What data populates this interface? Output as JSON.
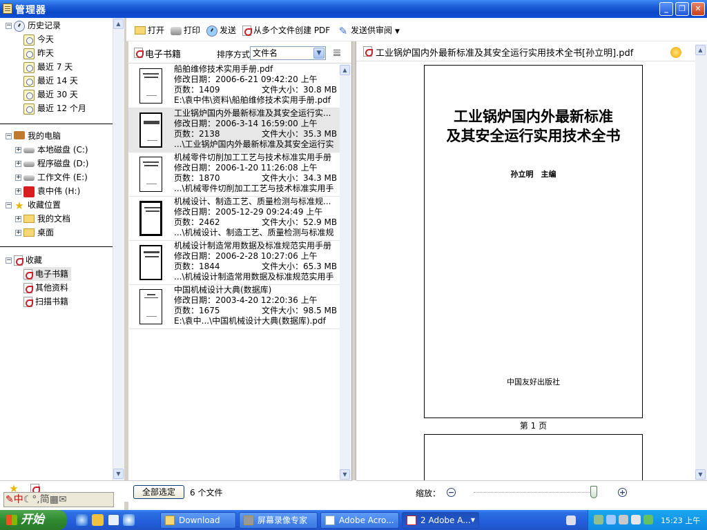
{
  "window": {
    "title": "管理器"
  },
  "sidebar": {
    "history": {
      "label": "历史记录",
      "items": [
        "今天",
        "昨天",
        "最近 7 天",
        "最近 14 天",
        "最近 30 天",
        "最近 12 个月"
      ]
    },
    "computer": {
      "label": "我的电脑",
      "drives": [
        "本地磁盘 (C:)",
        "程序磁盘 (D:)",
        "工作文件 (E:)",
        "袁中伟 (H:)"
      ]
    },
    "favorites_loc": {
      "label": "收藏位置",
      "items": [
        "我的文档",
        "桌面"
      ]
    },
    "collection": {
      "label": "收藏",
      "items": [
        "电子书籍",
        "其他资料",
        "扫描书籍"
      ]
    }
  },
  "toolbar": {
    "open": "打开",
    "print": "打印",
    "send": "发送",
    "create_pdf": "从多个文件创建 PDF",
    "review": "发送供审阅"
  },
  "list": {
    "title": "电子书籍",
    "sort_label": "排序方式",
    "sort_value": "文件名",
    "files": [
      {
        "name": "船舶维修技术实用手册.pdf",
        "date": "修改日期：2006-6-21 09:42:20 上午",
        "pages": "页数：1409",
        "size": "文件大小：30.8 MB",
        "path": "E:\\袁中伟\\资料\\船舶维修技术实用手册.pdf"
      },
      {
        "name": "工业锅炉国内外最新标准及其安全运行实...",
        "date": "修改日期：2006-3-14 16:59:00 上午",
        "pages": "页数：2138",
        "size": "文件大小：35.3 MB",
        "path": "...\\工业锅炉国内外最新标准及其安全运行实"
      },
      {
        "name": "机械零件切削加工工艺与技术标准实用手册",
        "date": "修改日期：2006-1-20 11:26:08 上午",
        "pages": "页数：1870",
        "size": "文件大小：34.3 MB",
        "path": "...\\机械零件切削加工工艺与技术标准实用手"
      },
      {
        "name": "机械设计、制造工艺、质量检测与标准规...",
        "date": "修改日期：2005-12-29 09:24:49 上午",
        "pages": "页数：2462",
        "size": "文件大小：52.9 MB",
        "path": "...\\机械设计、制造工艺、质量检测与标准规"
      },
      {
        "name": "机械设计制造常用数据及标准规范实用手册",
        "date": "修改日期：2006-2-28 10:27:06 上午",
        "pages": "页数：1844",
        "size": "文件大小：65.3 MB",
        "path": "...\\机械设计制造常用数据及标准规范实用手"
      },
      {
        "name": "中国机械设计大典(数据库)",
        "date": "修改日期：2003-4-20 12:20:36 上午",
        "pages": "页数：1675",
        "size": "文件大小：98.5 MB",
        "path": "E:\\袁中...\\中国机械设计大典(数据库).pdf"
      }
    ],
    "select_all": "全部选定",
    "count": "6 个文件"
  },
  "preview": {
    "file_title": "工业锅炉国内外最新标准及其安全运行实用技术全书[孙立明].pdf",
    "cover_title_line1": "工业锅炉国内外最新标准",
    "cover_title_line2": "及其安全运行实用技术全书",
    "cover_author": "孙立明　主编",
    "cover_publisher": "中国友好出版社",
    "page_label": "第 1 页",
    "zoom_label": "缩放：",
    "zoom_level": 0.95
  },
  "ime": {
    "text": "中"
  },
  "taskbar": {
    "start": "开始",
    "tasks": [
      "Download",
      "屏幕录像专家",
      "Adobe Acro...",
      "2 Adobe A..."
    ],
    "clock": "15:23 上午"
  }
}
